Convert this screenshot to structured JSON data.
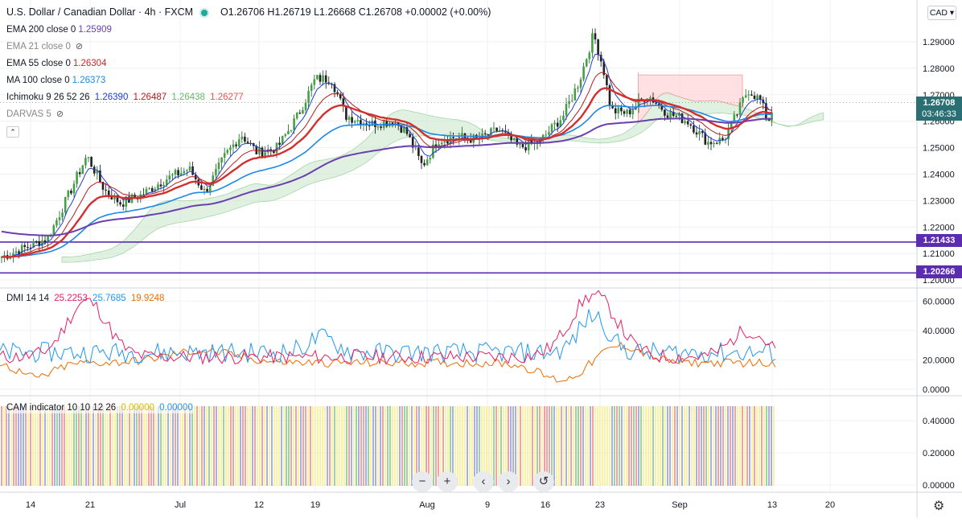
{
  "header": {
    "symbol": "U.S. Dollar / Canadian Dollar · 4h · FXCM",
    "ohlc": "O1.26706 H1.26719 L1.26668 C1.26708 +0.00002 (+0.00%)"
  },
  "legend": [
    {
      "label": "EMA 200 close 0",
      "value": "1.25909",
      "value_color": "#6a3fb0",
      "hidden": false
    },
    {
      "label": "EMA 21 close 0",
      "value": "",
      "value_color": "#888",
      "hidden": true
    },
    {
      "label": "EMA 55 close 0",
      "value": "1.26304",
      "value_color": "#c62828",
      "hidden": false
    },
    {
      "label": "MA 100 close 0",
      "value": "1.26373",
      "value_color": "#1e88e5",
      "hidden": false
    },
    {
      "label": "Ichimoku 9 26 52 26",
      "values": [
        "1.26390",
        "1.26487",
        "1.26438",
        "1.26277"
      ],
      "value_colors": [
        "#1e3fd0",
        "#b71c1c",
        "#66bb6a",
        "#ef5350"
      ],
      "hidden": false
    },
    {
      "label": "DARVAS 5",
      "value": "",
      "value_color": "#888",
      "hidden": true
    }
  ],
  "currency_button": "CAD",
  "price_axis": [
    "1.29000",
    "1.28000",
    "1.27000",
    "1.26000",
    "1.25000",
    "1.24000",
    "1.23000",
    "1.22000",
    "1.21000",
    "1.20000"
  ],
  "price_tags": {
    "current": "1.26708",
    "countdown": "03:46:33",
    "line1": "1.21433",
    "line2": "1.20266"
  },
  "dmi": {
    "label": "DMI 14 14",
    "v1": "25.2253",
    "v2": "25.7685",
    "v3": "19.9248",
    "axis": [
      "60.0000",
      "40.0000",
      "20.0000",
      "0.0000"
    ]
  },
  "cam": {
    "label": "CAM indicator 10 10 12 26",
    "v1": "0.00000",
    "v2": "0.00000",
    "axis": [
      "0.40000",
      "0.20000",
      "0.00000"
    ]
  },
  "time_axis": [
    "14",
    "21",
    "Jul",
    "12",
    "19",
    "Aug",
    "9",
    "16",
    "23",
    "Sep",
    "13",
    "20"
  ],
  "nav_buttons": [
    "−",
    "+",
    "‹",
    "›",
    "↺"
  ],
  "colors": {
    "up": "#26a69a",
    "down": "#ef5350",
    "ema200": "#6a3fb0",
    "ema55": "#d32f2f",
    "ma100": "#1e88e5",
    "tenkan": "#1e3fd0",
    "kijun": "#b71c1c",
    "dmi_plus": "#e91e63",
    "dmi_minus": "#2196f3",
    "adx": "#ef6c00",
    "hline": "#5b2bb0",
    "price_tag": "#2a6f73"
  }
}
